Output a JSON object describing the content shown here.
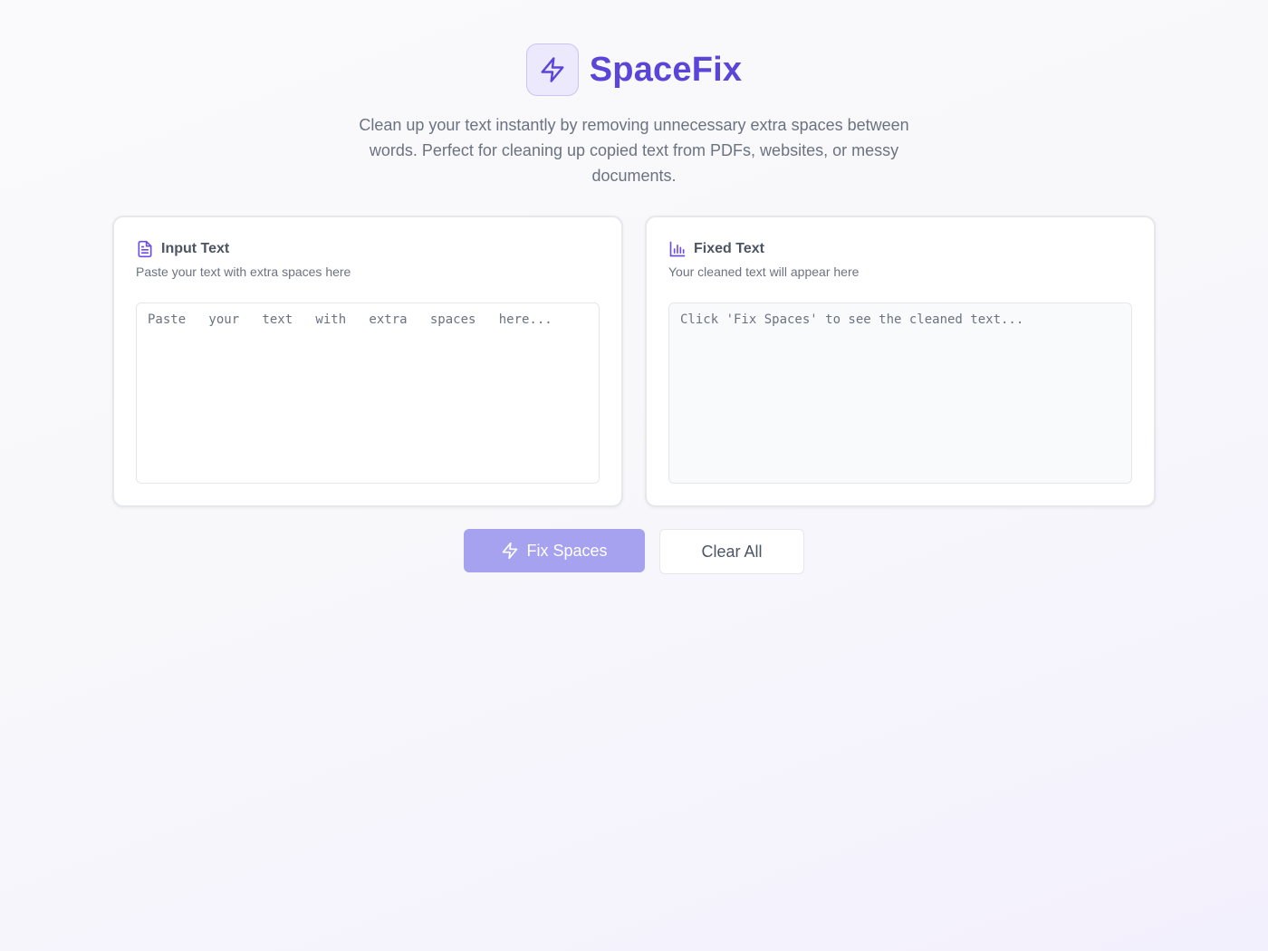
{
  "app": {
    "title": "SpaceFix",
    "tagline": "Clean up your text instantly by removing unnecessary extra spaces between words. Perfect for cleaning up copied text from PDFs, websites, or messy documents.",
    "logo_icon": "lightning-bolt-icon"
  },
  "input_panel": {
    "icon": "document-icon",
    "title": "Input Text",
    "subtitle": "Paste your text with extra spaces here",
    "placeholder": "Paste   your   text   with   extra   spaces   here...",
    "value": ""
  },
  "output_panel": {
    "icon": "bar-chart-icon",
    "title": "Fixed Text",
    "subtitle": "Your cleaned text will appear here",
    "placeholder": "Click 'Fix Spaces' to see the cleaned text...",
    "value": ""
  },
  "actions": {
    "fix_label": "Fix Spaces",
    "fix_icon": "lightning-bolt-icon",
    "clear_label": "Clear All"
  },
  "colors": {
    "brand": "#5b45d9",
    "primary_button": "#a6a2f0",
    "icon_accent": "#6d4fe0"
  }
}
